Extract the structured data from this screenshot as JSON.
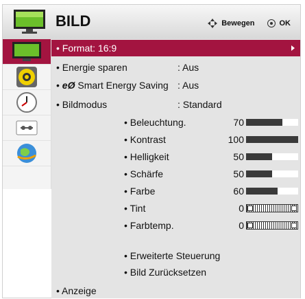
{
  "header": {
    "title": "BILD",
    "nav_move": "Bewegen",
    "nav_ok": "OK"
  },
  "sidebar": {
    "items": [
      "picture-icon",
      "speaker-icon",
      "clock-icon",
      "settings-icon",
      "globe-icon"
    ]
  },
  "menu": {
    "format": "• Format: 16:9",
    "energie_label": "• Energie sparen",
    "energie_value": ": Aus",
    "smart_label": "Smart Energy Saving",
    "smart_value": ": Aus",
    "bildmodus_label": "• Bildmodus",
    "bildmodus_value": ": Standard",
    "anzeige": "• Anzeige"
  },
  "settings": [
    {
      "label": "• Beleuchtung.",
      "value": "70",
      "level": 0.7,
      "kind": "bar"
    },
    {
      "label": "• Kontrast",
      "value": "100",
      "level": 1.0,
      "kind": "bar"
    },
    {
      "label": "• Helligkeit",
      "value": "50",
      "level": 0.5,
      "kind": "bar"
    },
    {
      "label": "• Schärfe",
      "value": "50",
      "level": 0.5,
      "kind": "bar"
    },
    {
      "label": "• Farbe",
      "value": "60",
      "level": 0.6,
      "kind": "bar"
    },
    {
      "label": "• Tint",
      "value": "0",
      "kind": "tint"
    },
    {
      "label": "• Farbtemp.",
      "value": "0",
      "kind": "tint"
    }
  ],
  "extra": {
    "erweitert": "• Erweiterte Steuerung",
    "reset": "• Bild Zurücksetzen"
  },
  "colors": {
    "accent": "#a31440",
    "panel": "#e4e4e4"
  }
}
